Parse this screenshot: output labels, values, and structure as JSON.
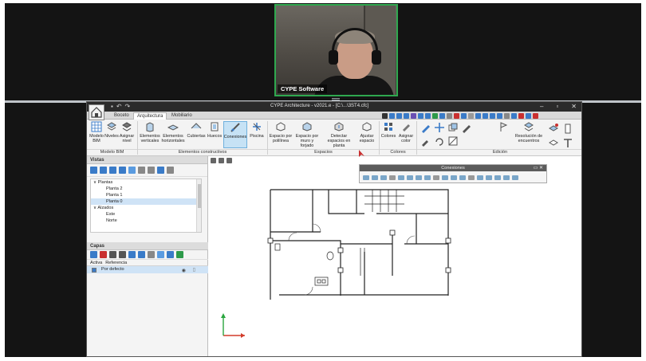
{
  "meeting": {
    "participant_name": "CYPE Software"
  },
  "app": {
    "window_title": "CYPE Architecture - v2021.e - [C:\\...\\3ST4.cfc]",
    "tabs": [
      "Boceto",
      "Arquitectura",
      "Mobiliario"
    ],
    "active_tab": "Arquitectura",
    "ribbon": {
      "buttons": [
        {
          "label": "Modelo BIM",
          "icon": "bim-model-icon"
        },
        {
          "label": "Niveles",
          "icon": "levels-icon"
        },
        {
          "label": "Asignar nivel",
          "icon": "assign-level-icon"
        },
        {
          "label": "Elementos verticales",
          "icon": "vertical-elements-icon"
        },
        {
          "label": "Elementos horizontales",
          "icon": "horizontal-elements-icon"
        },
        {
          "label": "Cubiertas",
          "icon": "roofs-icon"
        },
        {
          "label": "Huecos",
          "icon": "openings-icon"
        },
        {
          "label": "Conexiones",
          "icon": "connections-icon"
        },
        {
          "label": "Piscina",
          "icon": "pool-icon"
        },
        {
          "label": "Espacio por polilínea",
          "icon": "space-polyline-icon"
        },
        {
          "label": "Espacio por muro y forjado",
          "icon": "space-wall-icon"
        },
        {
          "label": "Detectar espacios en planta",
          "icon": "detect-spaces-icon"
        },
        {
          "label": "Ajustar espacio",
          "icon": "adjust-space-icon"
        },
        {
          "label": "Colores",
          "icon": "colors-icon"
        },
        {
          "label": "Asignar color",
          "icon": "assign-color-icon"
        },
        {
          "label": "Resolución de encuentros",
          "icon": "joins-icon"
        }
      ],
      "groups": [
        "Modelo BIM",
        "Elementos constructivos",
        "Espacios",
        "Colores",
        "Edición"
      ]
    },
    "vistas": {
      "header": "Vistas",
      "tree": [
        {
          "label": "Plantas",
          "expanded": true,
          "indent": 0
        },
        {
          "label": "Planta 2",
          "indent": 1
        },
        {
          "label": "Planta 1",
          "indent": 1
        },
        {
          "label": "Planta 0",
          "indent": 1,
          "selected": true
        },
        {
          "label": "Alzados",
          "expanded": true,
          "indent": 0
        },
        {
          "label": "Este",
          "indent": 1
        },
        {
          "label": "Norte",
          "indent": 1
        }
      ]
    },
    "capas": {
      "header": "Capas",
      "col_activa": "Activa",
      "col_referencia": "Referencia",
      "rows": [
        {
          "name": "Por defecto",
          "active": true
        }
      ]
    },
    "floating_toolbar": {
      "title": "Conexiones"
    }
  },
  "colors": {
    "meeting_bg": "#141414",
    "speaker_border": "#2fa84f",
    "title_bar": "#2b2b2b",
    "ribbon_selected": "#c6e2f5",
    "axis_x": "#d23c2a",
    "axis_y": "#2aa63f"
  }
}
